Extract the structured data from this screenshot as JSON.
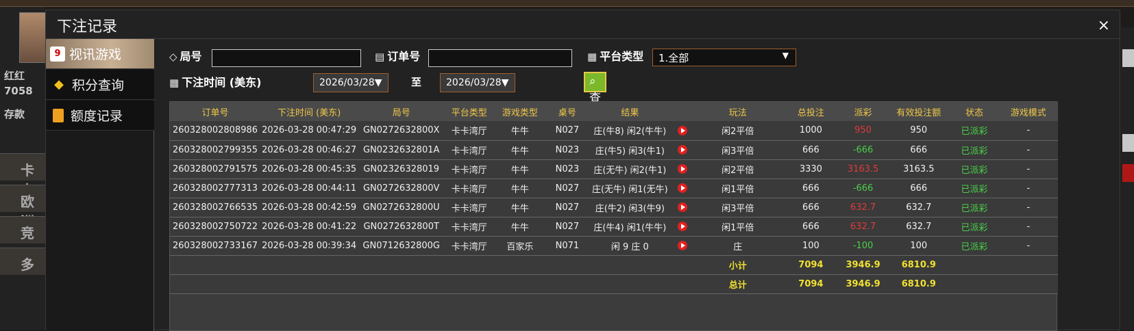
{
  "background": {
    "left_rows": [
      "卡卡",
      "欧洲",
      "竞",
      "多"
    ],
    "left_texts": [
      "红红",
      "7058",
      "存款"
    ]
  },
  "modal": {
    "title": "下注记录",
    "close_label": "×"
  },
  "sidebar": {
    "items": [
      {
        "label": "视讯游戏",
        "icon": "cards-icon",
        "active": true
      },
      {
        "label": "积分查询",
        "icon": "diamond-icon",
        "active": false
      },
      {
        "label": "额度记录",
        "icon": "document-icon",
        "active": false
      }
    ]
  },
  "filters": {
    "round_label": "局号",
    "round_value": "",
    "order_label": "订单号",
    "order_value": "",
    "platform_label": "平台类型",
    "platform_value": "1.全部",
    "time_label": "下注时间 (美东)",
    "date_from": "2026/03/28▼",
    "to_label": "至",
    "date_to": "2026/03/28▼",
    "query_label": "查询"
  },
  "table": {
    "columns": [
      "订单号",
      "下注时间 (美东)",
      "局号",
      "平台类型",
      "游戏类型",
      "桌号",
      "结果",
      "",
      "玩法",
      "总投注",
      "派彩",
      "有效投注额",
      "状态",
      "游戏模式"
    ],
    "rows": [
      {
        "order": "260328002808986",
        "time": "2026-03-28 00:47:29",
        "round": "GN0272632800X",
        "platform": "卡卡湾厅",
        "game": "牛牛",
        "table": "N027",
        "result": "庄(牛8) 闲2(牛牛)",
        "play": "闲2平倍",
        "bet": "1000",
        "payout": "950",
        "payout_sign": "pos",
        "valid": "950",
        "status": "已派彩",
        "mode": "-"
      },
      {
        "order": "260328002799355",
        "time": "2026-03-28 00:46:27",
        "round": "GN0232632801A",
        "platform": "卡卡湾厅",
        "game": "牛牛",
        "table": "N023",
        "result": "庄(牛5) 闲3(牛1)",
        "play": "闲3平倍",
        "bet": "666",
        "payout": "-666",
        "payout_sign": "neg",
        "valid": "666",
        "status": "已派彩",
        "mode": "-"
      },
      {
        "order": "260328002791575",
        "time": "2026-03-28 00:45:35",
        "round": "GN02326328019",
        "platform": "卡卡湾厅",
        "game": "牛牛",
        "table": "N023",
        "result": "庄(无牛) 闲2(牛1)",
        "play": "闲2平倍",
        "bet": "3330",
        "payout": "3163.5",
        "payout_sign": "pos",
        "valid": "3163.5",
        "status": "已派彩",
        "mode": "-"
      },
      {
        "order": "260328002777313",
        "time": "2026-03-28 00:44:11",
        "round": "GN0272632800V",
        "platform": "卡卡湾厅",
        "game": "牛牛",
        "table": "N027",
        "result": "庄(无牛) 闲1(无牛)",
        "play": "闲1平倍",
        "bet": "666",
        "payout": "-666",
        "payout_sign": "neg",
        "valid": "666",
        "status": "已派彩",
        "mode": "-"
      },
      {
        "order": "260328002766535",
        "time": "2026-03-28 00:42:59",
        "round": "GN0272632800U",
        "platform": "卡卡湾厅",
        "game": "牛牛",
        "table": "N027",
        "result": "庄(牛2) 闲3(牛9)",
        "play": "闲3平倍",
        "bet": "666",
        "payout": "632.7",
        "payout_sign": "pos",
        "valid": "632.7",
        "status": "已派彩",
        "mode": "-"
      },
      {
        "order": "260328002750722",
        "time": "2026-03-28 00:41:22",
        "round": "GN0272632800T",
        "platform": "卡卡湾厅",
        "game": "牛牛",
        "table": "N027",
        "result": "庄(牛4) 闲1(牛牛)",
        "play": "闲1平倍",
        "bet": "666",
        "payout": "632.7",
        "payout_sign": "pos",
        "valid": "632.7",
        "status": "已派彩",
        "mode": "-"
      },
      {
        "order": "260328002733167",
        "time": "2026-03-28 00:39:34",
        "round": "GN0712632800G",
        "platform": "卡卡湾厅",
        "game": "百家乐",
        "table": "N071",
        "result": "闲 9 庄 0",
        "play": "庄",
        "bet": "100",
        "payout": "-100",
        "payout_sign": "neg",
        "valid": "100",
        "status": "已派彩",
        "mode": "-"
      }
    ],
    "subtotal": {
      "label": "小计",
      "bet": "7094",
      "payout": "3946.9",
      "valid": "6810.9"
    },
    "total": {
      "label": "总计",
      "bet": "7094",
      "payout": "3946.9",
      "valid": "6810.9"
    }
  }
}
